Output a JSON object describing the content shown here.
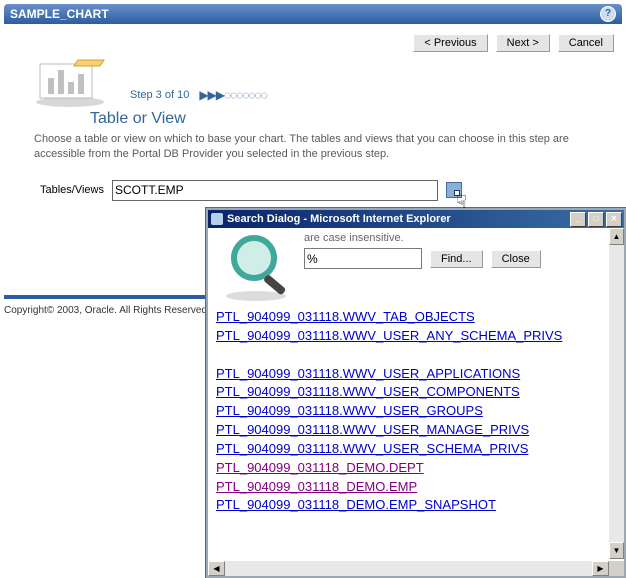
{
  "header": {
    "title": "SAMPLE_CHART",
    "buttons": {
      "prev": "< Previous",
      "next": "Next >",
      "cancel": "Cancel"
    }
  },
  "step": {
    "label": "Step 3 of 10"
  },
  "section": {
    "heading": "Table or View",
    "description": "Choose a table or view on which to base your chart. The tables and views that you can choose in this step are accessible from the Portal DB Provider you selected in the previous step."
  },
  "form": {
    "label": "Tables/Views",
    "value": "SCOTT.EMP"
  },
  "copyright": "Copyright© 2003, Oracle. All Rights Reserved",
  "popup": {
    "title": "Search Dialog - Microsoft Internet Explorer",
    "case_text": "are case insensitive.",
    "search_value": "%",
    "buttons": {
      "find": "Find...",
      "close": "Close"
    },
    "results": [
      {
        "text": "PTL_904099_031118.WWV_TAB_OBJECTS",
        "visited": false
      },
      {
        "text": "PTL_904099_031118.WWV_USER_ANY_SCHEMA_PRIVS",
        "visited": false
      },
      {
        "text": "",
        "visited": false
      },
      {
        "text": "PTL_904099_031118.WWV_USER_APPLICATIONS",
        "visited": false
      },
      {
        "text": "PTL_904099_031118.WWV_USER_COMPONENTS",
        "visited": false
      },
      {
        "text": "PTL_904099_031118.WWV_USER_GROUPS",
        "visited": false
      },
      {
        "text": "PTL_904099_031118.WWV_USER_MANAGE_PRIVS",
        "visited": false
      },
      {
        "text": "PTL_904099_031118.WWV_USER_SCHEMA_PRIVS",
        "visited": false
      },
      {
        "text": "PTL_904099_031118_DEMO.DEPT",
        "visited": true
      },
      {
        "text": "PTL_904099_031118_DEMO.EMP",
        "visited": true
      },
      {
        "text": "PTL_904099_031118_DEMO.EMP_SNAPSHOT",
        "visited": false
      }
    ]
  }
}
